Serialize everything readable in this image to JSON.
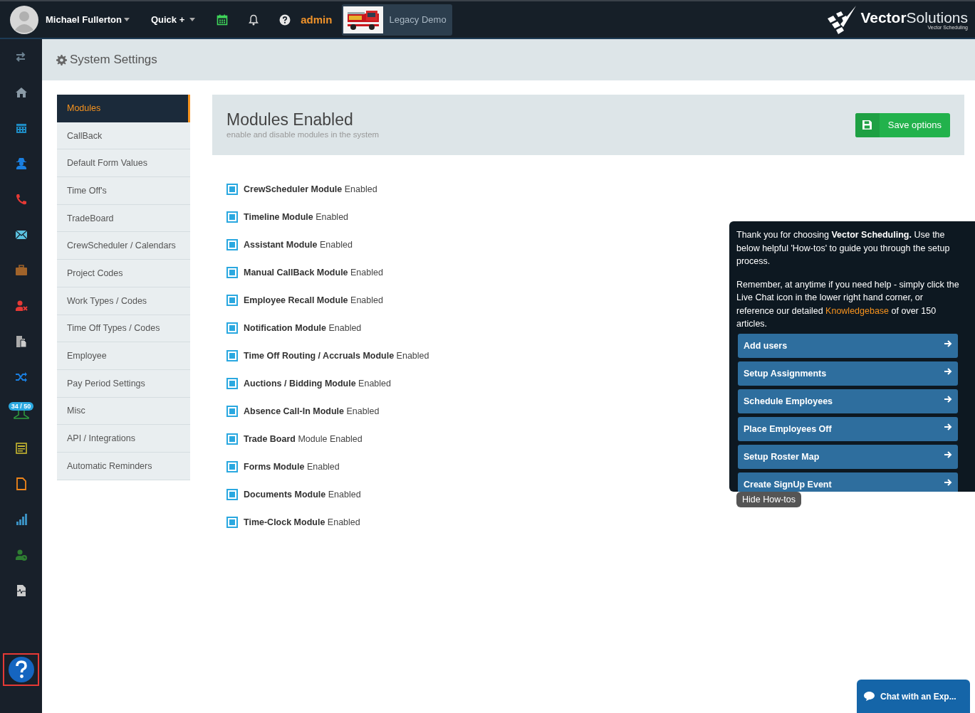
{
  "topbar": {
    "user_name": "Michael Fullerton",
    "quick": "Quick +",
    "admin": "admin",
    "account": "Legacy Demo",
    "logo_bold": "Vector",
    "logo_light": "Solutions",
    "logo_sub": "Vector Scheduling"
  },
  "sidebar": {
    "badge": "34 / 50"
  },
  "page_title": "System Settings",
  "settings_nav": [
    {
      "label": "Modules",
      "selected": true
    },
    {
      "label": "CallBack",
      "selected": false
    },
    {
      "label": "Default Form Values",
      "selected": false
    },
    {
      "label": "Time Off's",
      "selected": false
    },
    {
      "label": "TradeBoard",
      "selected": false
    },
    {
      "label": "CrewScheduler / Calendars",
      "selected": false
    },
    {
      "label": "Project Codes",
      "selected": false
    },
    {
      "label": "Work Types / Codes",
      "selected": false
    },
    {
      "label": "Time Off Types / Codes",
      "selected": false
    },
    {
      "label": "Employee",
      "selected": false
    },
    {
      "label": "Pay Period Settings",
      "selected": false
    },
    {
      "label": "Misc",
      "selected": false
    },
    {
      "label": "API / Integrations",
      "selected": false
    },
    {
      "label": "Automatic Reminders",
      "selected": false
    }
  ],
  "panel": {
    "title": "Modules Enabled",
    "subtitle": "enable and disable modules in the system",
    "save": "Save options"
  },
  "modules": [
    {
      "label": "**CrewScheduler Module** Enabled",
      "checked": true
    },
    {
      "label": "**Timeline Module** Enabled",
      "checked": true
    },
    {
      "label": "**Assistant Module** Enabled",
      "checked": true
    },
    {
      "label": "**Manual CallBack Module** Enabled",
      "checked": true
    },
    {
      "label": "**Employee Recall Module** Enabled",
      "checked": true
    },
    {
      "label": "**Notification Module** Enabled",
      "checked": true
    },
    {
      "label": "**Time Off Routing / Accruals Module** Enabled",
      "checked": true
    },
    {
      "label": "**Auctions / Bidding Module** Enabled",
      "checked": true
    },
    {
      "label": "**Absence Call-In Module** Enabled",
      "checked": true
    },
    {
      "label": "**Trade Board** Module Enabled",
      "checked": true
    },
    {
      "label": "**Forms Module** Enabled",
      "checked": true
    },
    {
      "label": "**Documents Module** Enabled",
      "checked": true
    },
    {
      "label": "**Time-Clock Module** Enabled",
      "checked": true
    }
  ],
  "howto": {
    "intro": "Thank you for choosing **Vector Scheduling.** Use the below helpful 'How-tos' to guide you through the setup process.",
    "reminder_before": "Remember, at anytime if you need help - simply click the Live Chat icon in the lower right hand corner, or reference our detailed ",
    "link": "Knowledgebase",
    "reminder_after": " of over 150 articles.",
    "items": [
      "Add users",
      "Setup Assignments",
      "Schedule Employees",
      "Place Employees Off",
      "Setup Roster Map",
      "Create SignUp Event"
    ],
    "hide": "Hide How-tos"
  },
  "chat": {
    "label": "Chat with an Exp..."
  }
}
